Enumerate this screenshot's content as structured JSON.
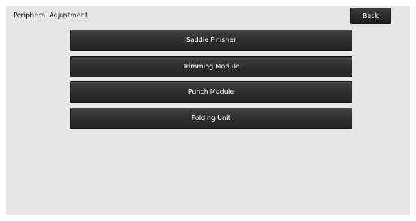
{
  "header": {
    "title": "Peripheral Adjustment",
    "back_label": "Back"
  },
  "menu": {
    "items": [
      {
        "label": "Saddle Finisher"
      },
      {
        "label": "Trimming Module"
      },
      {
        "label": "Punch Module"
      },
      {
        "label": "Folding Unit"
      }
    ]
  },
  "colors": {
    "panel_background": "#e6e6e6",
    "button_background": "#2d2d2d",
    "button_text": "#ffffff"
  }
}
